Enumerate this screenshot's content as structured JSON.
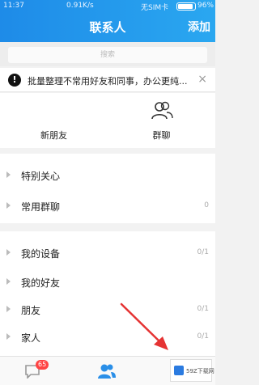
{
  "status_bar": {
    "time": "11:37",
    "speed": "0.91K/s",
    "network": "无SIM卡",
    "battery": "96%"
  },
  "header": {
    "title": "联系人",
    "add_label": "添加"
  },
  "search": {
    "placeholder": "搜索"
  },
  "notice": {
    "icon": "!",
    "text": "批量整理不常用好友和同事，办公更纯...",
    "close": "×"
  },
  "quick_entries": [
    {
      "label": "新朋友",
      "icon": "person-add-icon"
    },
    {
      "label": "群聊",
      "icon": "group-icon"
    }
  ],
  "groups": [
    {
      "label": "特别关心",
      "count": ""
    },
    {
      "label": "常用群聊",
      "count": "0"
    },
    {
      "label": "我的设备",
      "count": "0/1"
    },
    {
      "label": "我的好友",
      "count": ""
    },
    {
      "label": "朋友",
      "count": "0/1"
    },
    {
      "label": "家人",
      "count": "0/1"
    }
  ],
  "tabbar": {
    "badge": "65"
  },
  "watermark": {
    "text": "59Z下载网"
  },
  "colors": {
    "header_blue": "#2596ea",
    "annotation_red": "#e53333",
    "badge_red": "#ff4444"
  }
}
